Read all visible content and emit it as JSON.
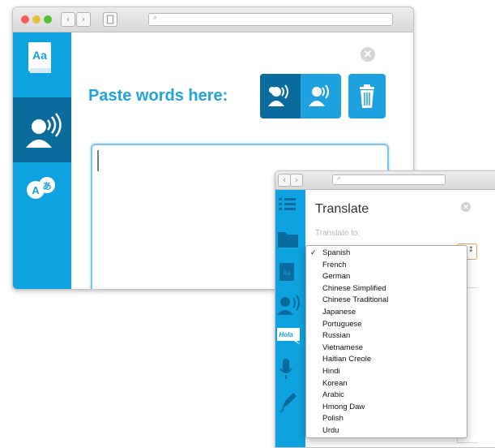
{
  "window1": {
    "title": "Paste words here:",
    "sidebar": {
      "tabs": [
        {
          "name": "dictionary",
          "label": "Aa"
        },
        {
          "name": "speech",
          "label": ""
        },
        {
          "name": "translate",
          "label": "A"
        }
      ]
    }
  },
  "window2": {
    "title": "Translate",
    "translate_label": "Translate to:",
    "selected_language": "Spanish",
    "sidebar": {
      "hola_label": "Hola"
    }
  },
  "dropdown": {
    "options": [
      "Spanish",
      "French",
      "German",
      "Chinese Simplified",
      "Chinese Traditional",
      "Japanese",
      "Portuguese",
      "Russian",
      "Vietnamese",
      "Haitian Creole",
      "Hindi",
      "Korean",
      "Arabic",
      "Hmong Daw",
      "Polish",
      "Urdu"
    ],
    "checked_index": 0
  },
  "colors": {
    "brand_blue": "#0fa2e0",
    "dark_blue": "#0a6c9c",
    "title_blue": "#21a3de",
    "select_focus_orange": "#e8a356"
  }
}
